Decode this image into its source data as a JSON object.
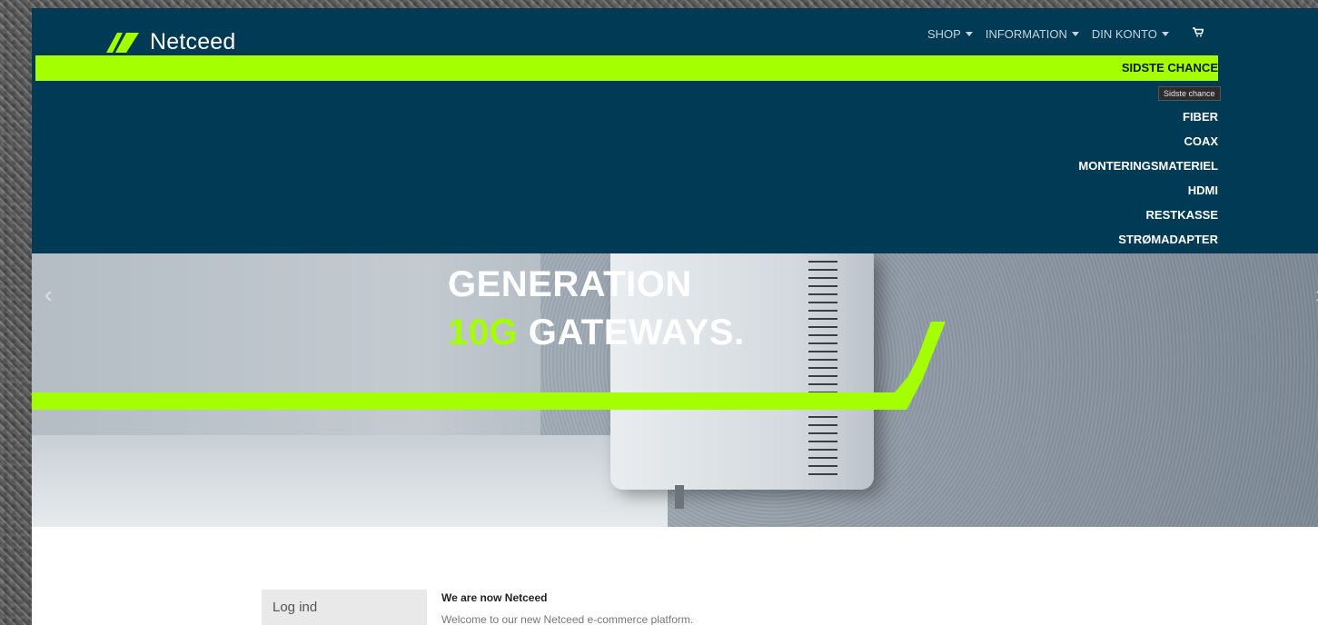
{
  "brand": {
    "name": "Netceed",
    "accent": "#a4ff00",
    "header_bg": "#003a55"
  },
  "topnav": [
    {
      "label": "SHOP",
      "icon": "caret-down-icon"
    },
    {
      "label": "INFORMATION",
      "icon": "caret-down-icon"
    },
    {
      "label": "DIN KONTO",
      "icon": "caret-down-icon"
    }
  ],
  "cart_icon": "cart-icon",
  "dropdown": {
    "highlighted": "SIDSTE CHANCE",
    "tooltip": "Sidste chance",
    "items": [
      "FIBER",
      "COAX",
      "MONTERINGSMATERIEL",
      "HDMI",
      "RESTKASSE",
      "STRØMADAPTER"
    ]
  },
  "hero": {
    "line1": "GENERATION",
    "line2_highlight": "10G",
    "line2_rest": " GATEWAYS."
  },
  "login": {
    "label": "Log ind"
  },
  "welcome": {
    "title": "We are now Netceed",
    "text": "Welcome to our new Netceed e-commerce platform."
  }
}
